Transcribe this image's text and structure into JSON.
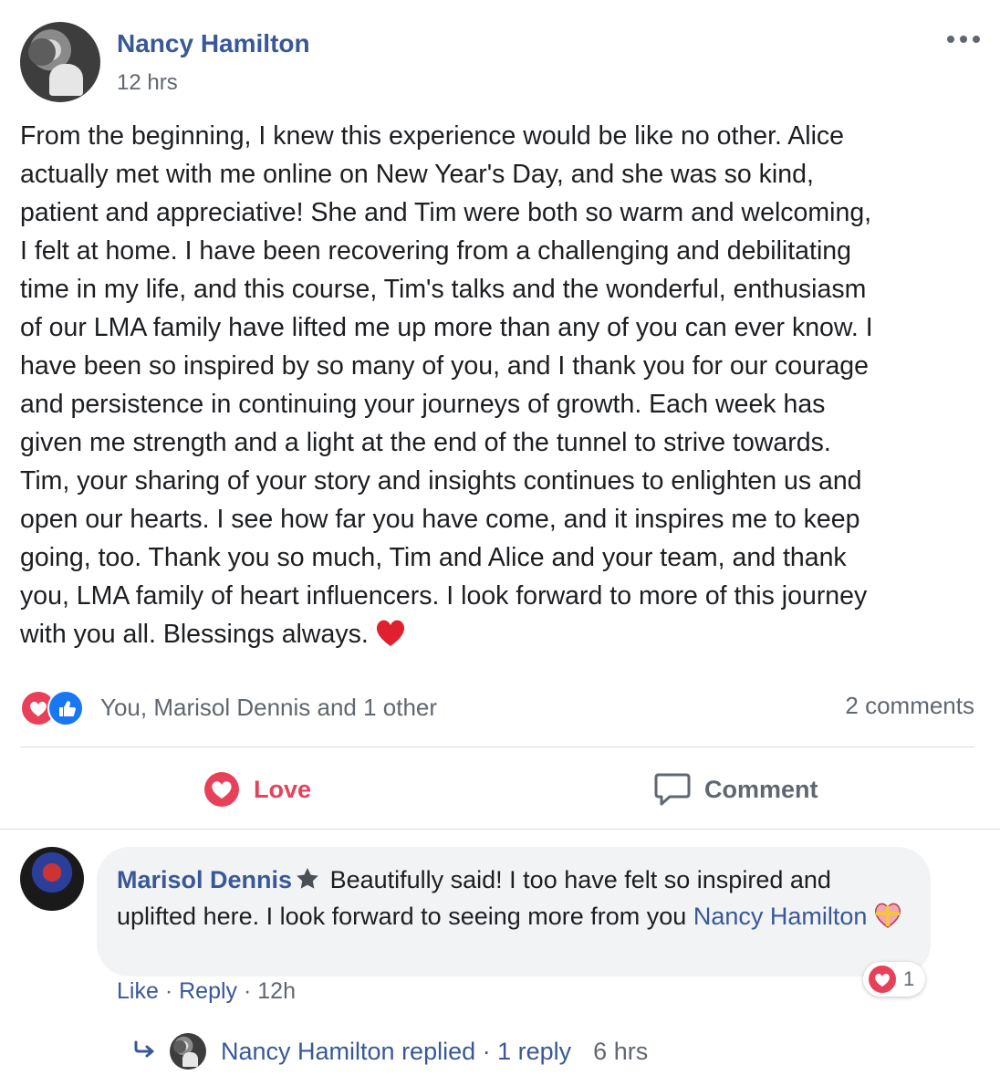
{
  "post": {
    "author": "Nancy Hamilton",
    "time": "12 hrs",
    "more_icon": "ellipsis-icon",
    "body": "From the beginning, I knew this experience would be like no other. Alice\nactually met with me online on New Year's Day, and she was so kind,\npatient and appreciative! She and Tim were both so warm and welcoming,\nI felt at home. I have been recovering from a challenging and debilitating\ntime in my life, and this course, Tim's talks and the wonderful, enthusiasm\nof our LMA family have lifted me up more than any of you can ever know. I\nhave been so inspired by so many of you, and I thank you for our courage\nand persistence in continuing your journeys of growth. Each week has\ngiven me strength and a light at the end of the tunnel to strive towards.\nTim, your sharing of your story and insights continues to enlighten us and\nopen our hearts. I see how far you have come, and it inspires me to keep\ngoing, too. Thank you so much, Tim and Alice and your team, and thank\nyou, LMA family of heart influencers. I look forward to more of this journey\nwith you all. Blessings always."
  },
  "reactions": {
    "summary": "You, Marisol Dennis and 1 other",
    "comments_count": "2 comments"
  },
  "actions": {
    "love_label": "Love",
    "comment_label": "Comment"
  },
  "comment": {
    "author": "Marisol Dennis",
    "text": "Beautifully said! I too have felt so inspired and uplifted here. I look forward to seeing more from you",
    "mention": "Nancy Hamilton",
    "reaction_count": "1",
    "like_label": "Like",
    "reply_label": "Reply",
    "time": "12h"
  },
  "replies": {
    "replied_text": "Nancy Hamilton replied · 1 reply",
    "time": "6 hrs"
  },
  "colors": {
    "link": "#385898",
    "love": "#e9405a",
    "like": "#1877f2",
    "muted": "#606770"
  }
}
